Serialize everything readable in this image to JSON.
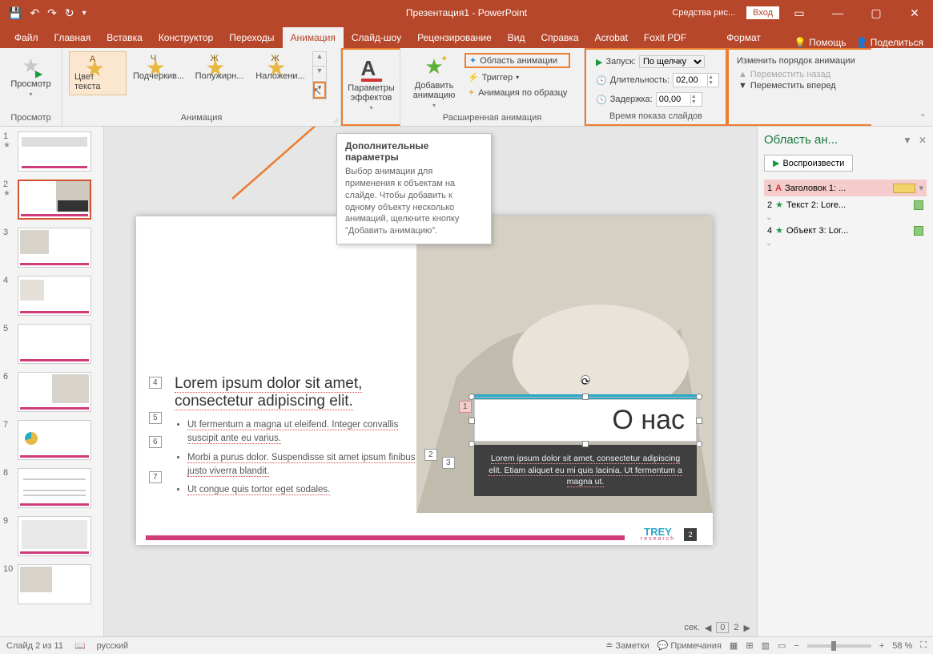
{
  "titlebar": {
    "title": "Презентация1 - PowerPoint",
    "tool_context": "Средства рис...",
    "login": "Вход"
  },
  "tabs": {
    "file": "Файл",
    "home": "Главная",
    "insert": "Вставка",
    "design": "Конструктор",
    "transitions": "Переходы",
    "animations": "Анимация",
    "slideshow": "Слайд-шоу",
    "review": "Рецензирование",
    "view": "Вид",
    "help": "Справка",
    "acrobat": "Acrobat",
    "foxit": "Foxit PDF",
    "format": "Формат",
    "assist": "Помощь",
    "share": "Поделиться"
  },
  "ribbon": {
    "preview": "Просмотр",
    "preview_grp": "Просмотр",
    "anim1": "Цвет текста",
    "anim2": "Подчеркив...",
    "anim3": "Полужирн...",
    "anim4": "Наложени...",
    "anim_grp": "Анимация",
    "params": "Параметры эффектов",
    "add_anim": "Добавить анимацию",
    "pane": "Область анимации",
    "trigger": "Триггер",
    "painter": "Анимация по образцу",
    "adv_grp": "Расширенная анимация",
    "start_lbl": "Запуск:",
    "start_val": "По щелчку",
    "dur_lbl": "Длительность:",
    "dur_val": "02,00",
    "delay_lbl": "Задержка:",
    "delay_val": "00,00",
    "timing_grp": "Время показа слайдов",
    "reorder": "Изменить порядок анимации",
    "move_back": "Переместить назад",
    "move_fwd": "Переместить вперед"
  },
  "tooltip": {
    "title": "Дополнительные параметры",
    "body": "Выбор анимации для применения к объектам на слайде. Чтобы добавить к одному объекту несколько анимаций, щелкните кнопку \"Добавить анимацию\"."
  },
  "slide": {
    "heading1": "Lorem ipsum dolor sit amet,",
    "heading2": "consectetur adipiscing elit.",
    "b1": "Ut fermentum a magna ut eleifend. Integer convallis suscipit ante eu varius.",
    "b2": "Morbi a purus dolor. Suspendisse sit amet ipsum finibus justo viverra blandit.",
    "b3": "Ut congue quis tortor eget sodales.",
    "about": "О нас",
    "card_text": "Lorem ipsum dolor sit amet, consectetur adipiscing elit. Etiam aliquet eu mi quis lacinia. Ut fermentum a magna ut.",
    "brand1": "TREY",
    "brand2": "research",
    "page": "2"
  },
  "pane": {
    "title": "Область ан...",
    "play": "Воспроизвести",
    "i1": "Заголовок 1: ...",
    "i2": "Текст 2: Lore...",
    "i3": "Объект 3: Lor..."
  },
  "status": {
    "slide": "Слайд 2 из 11",
    "lang": "русский",
    "notes": "Заметки",
    "comments": "Примечания",
    "zoom": "58 %",
    "sec": "сек.",
    "seek_cur": "0",
    "seek_total": "2"
  }
}
